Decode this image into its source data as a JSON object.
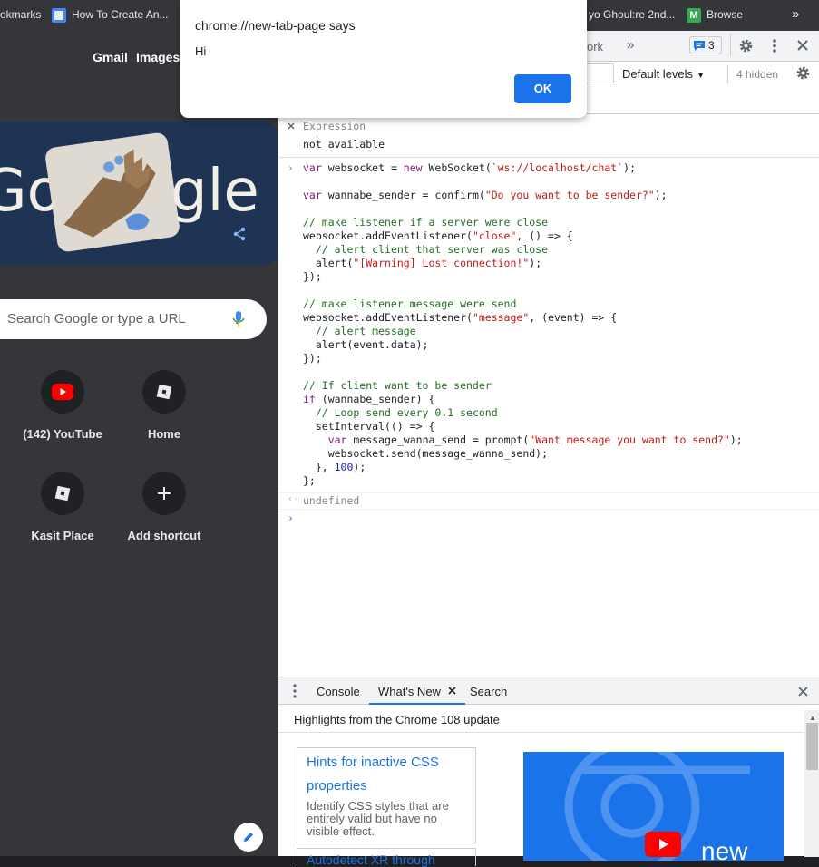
{
  "bookmarks": {
    "item1": "okmarks",
    "item2": "How To Create An...",
    "item3": "yo Ghoul:re 2nd...",
    "item4": "Browse",
    "more": "»"
  },
  "ntp": {
    "gmail": "Gmail",
    "images": "Images",
    "doodle_left": "Go",
    "doodle_right": "gle",
    "search_placeholder": "Search Google or type a URL",
    "shortcuts": [
      {
        "label": "(142) YouTube"
      },
      {
        "label": "Home"
      },
      {
        "label": "Kasit Place"
      },
      {
        "label": "Add shortcut"
      }
    ]
  },
  "devtools": {
    "tab_network": "ork",
    "more_tabs": "»",
    "issues_count": "3",
    "levels": "Default levels",
    "hidden": "4 hidden",
    "watch": {
      "label": "Expression",
      "value": "not available"
    },
    "result": "undefined"
  },
  "drawer": {
    "tabs": [
      "Console",
      "What's New",
      "Search"
    ],
    "header": "Highlights from the Chrome 108 update",
    "card_title_1": "Hints for inactive CSS",
    "card_title_2": "properties",
    "card_desc": "Identify CSS styles that are entirely valid but have no visible effect.",
    "card2_title": "Autodetect XR through",
    "banner_text": "new"
  },
  "dialog": {
    "title": "chrome://new-tab-page says",
    "message": "Hi",
    "ok": "OK"
  },
  "colors": {
    "accent": "#1a73e8",
    "youtube": "#ff0000",
    "keyword": "#881280",
    "string": "#c41a16",
    "comment": "#236e25"
  }
}
